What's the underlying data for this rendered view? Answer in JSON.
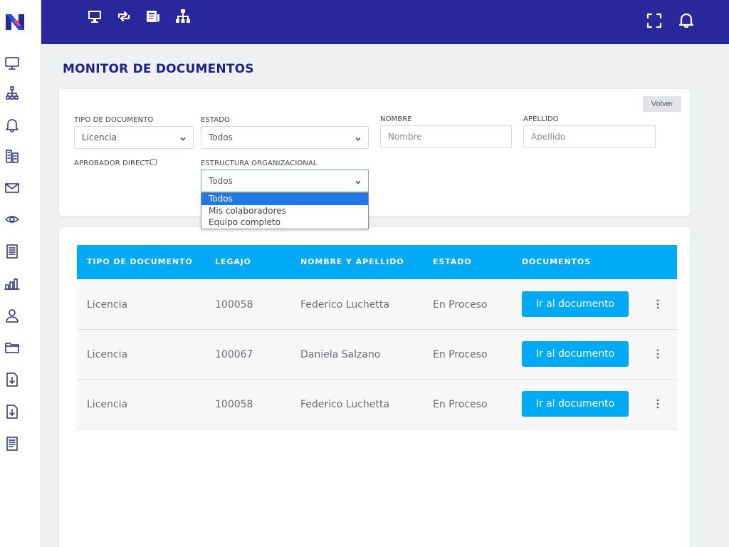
{
  "page": {
    "title": "MONITOR DE DOCUMENTOS"
  },
  "sidebar": {
    "logo": "logo-n",
    "icons": [
      "monitor-icon",
      "org-chart-icon",
      "bell-icon",
      "building-icon",
      "mail-icon",
      "eye-icon",
      "document-icon",
      "bar-chart-icon",
      "user-icon",
      "folder-icon",
      "download-doc-icon",
      "download-doc-icon",
      "document-list-icon"
    ]
  },
  "topbar": {
    "left_icons": [
      "monitor-icon",
      "sync-icon",
      "newspaper-icon",
      "org-chart-icon"
    ],
    "right_icons": [
      "fullscreen-icon",
      "bell-icon"
    ],
    "color": "#28289c"
  },
  "filters": {
    "back_label": "Volver",
    "tipo_documento": {
      "label": "TIPO DE DOCUMENTO",
      "value": "Licencia"
    },
    "estado": {
      "label": "ESTADO",
      "value": "Todos"
    },
    "nombre": {
      "label": "NOMBRE",
      "placeholder": "Nombre"
    },
    "apellido": {
      "label": "APELLIDO",
      "placeholder": "Apellido"
    },
    "aprobador": {
      "label": "APROBADOR DIRECTO",
      "checked": false
    },
    "estructura": {
      "label": "ESTRUCTURA ORGANIZACIONAL",
      "value": "Todos",
      "options": [
        "Todos",
        "Mis colaboradores",
        "Equipo completo"
      ],
      "selected_index": 0
    }
  },
  "table": {
    "headers": [
      "TIPO DE DOCUMENTO",
      "LEGAJO",
      "NOMBRE Y APELLIDO",
      "ESTADO",
      "DOCUMENTOS"
    ],
    "rows": [
      {
        "tipo": "Licencia",
        "legajo": "100058",
        "nombre": "Federico Luchetta",
        "estado": "En Proceso",
        "doc_label": "Ir al documento"
      },
      {
        "tipo": "Licencia",
        "legajo": "100067",
        "nombre": "Daniela Salzano",
        "estado": "En Proceso",
        "doc_label": "Ir al documento"
      },
      {
        "tipo": "Licencia",
        "legajo": "100058",
        "nombre": "Federico Luchetta",
        "estado": "En Proceso",
        "doc_label": "Ir al documento"
      }
    ],
    "header_color": "#00aaf5"
  }
}
